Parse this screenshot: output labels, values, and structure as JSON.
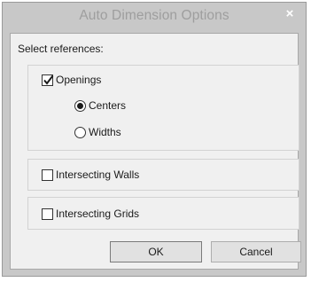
{
  "dialog": {
    "title": "Auto Dimension Options",
    "close_label": "×"
  },
  "references": {
    "heading": "Select references:",
    "openings": {
      "label": "Openings",
      "checked": true
    },
    "centers": {
      "label": "Centers",
      "selected": true
    },
    "widths": {
      "label": "Widths",
      "selected": false
    },
    "intersecting_walls": {
      "label": "Intersecting Walls",
      "checked": false
    },
    "intersecting_grids": {
      "label": "Intersecting Grids",
      "checked": false
    }
  },
  "buttons": {
    "ok_label": "OK",
    "cancel_label": "Cancel"
  },
  "icons": {
    "close": "close-icon",
    "checkmark": "checkmark-icon"
  }
}
